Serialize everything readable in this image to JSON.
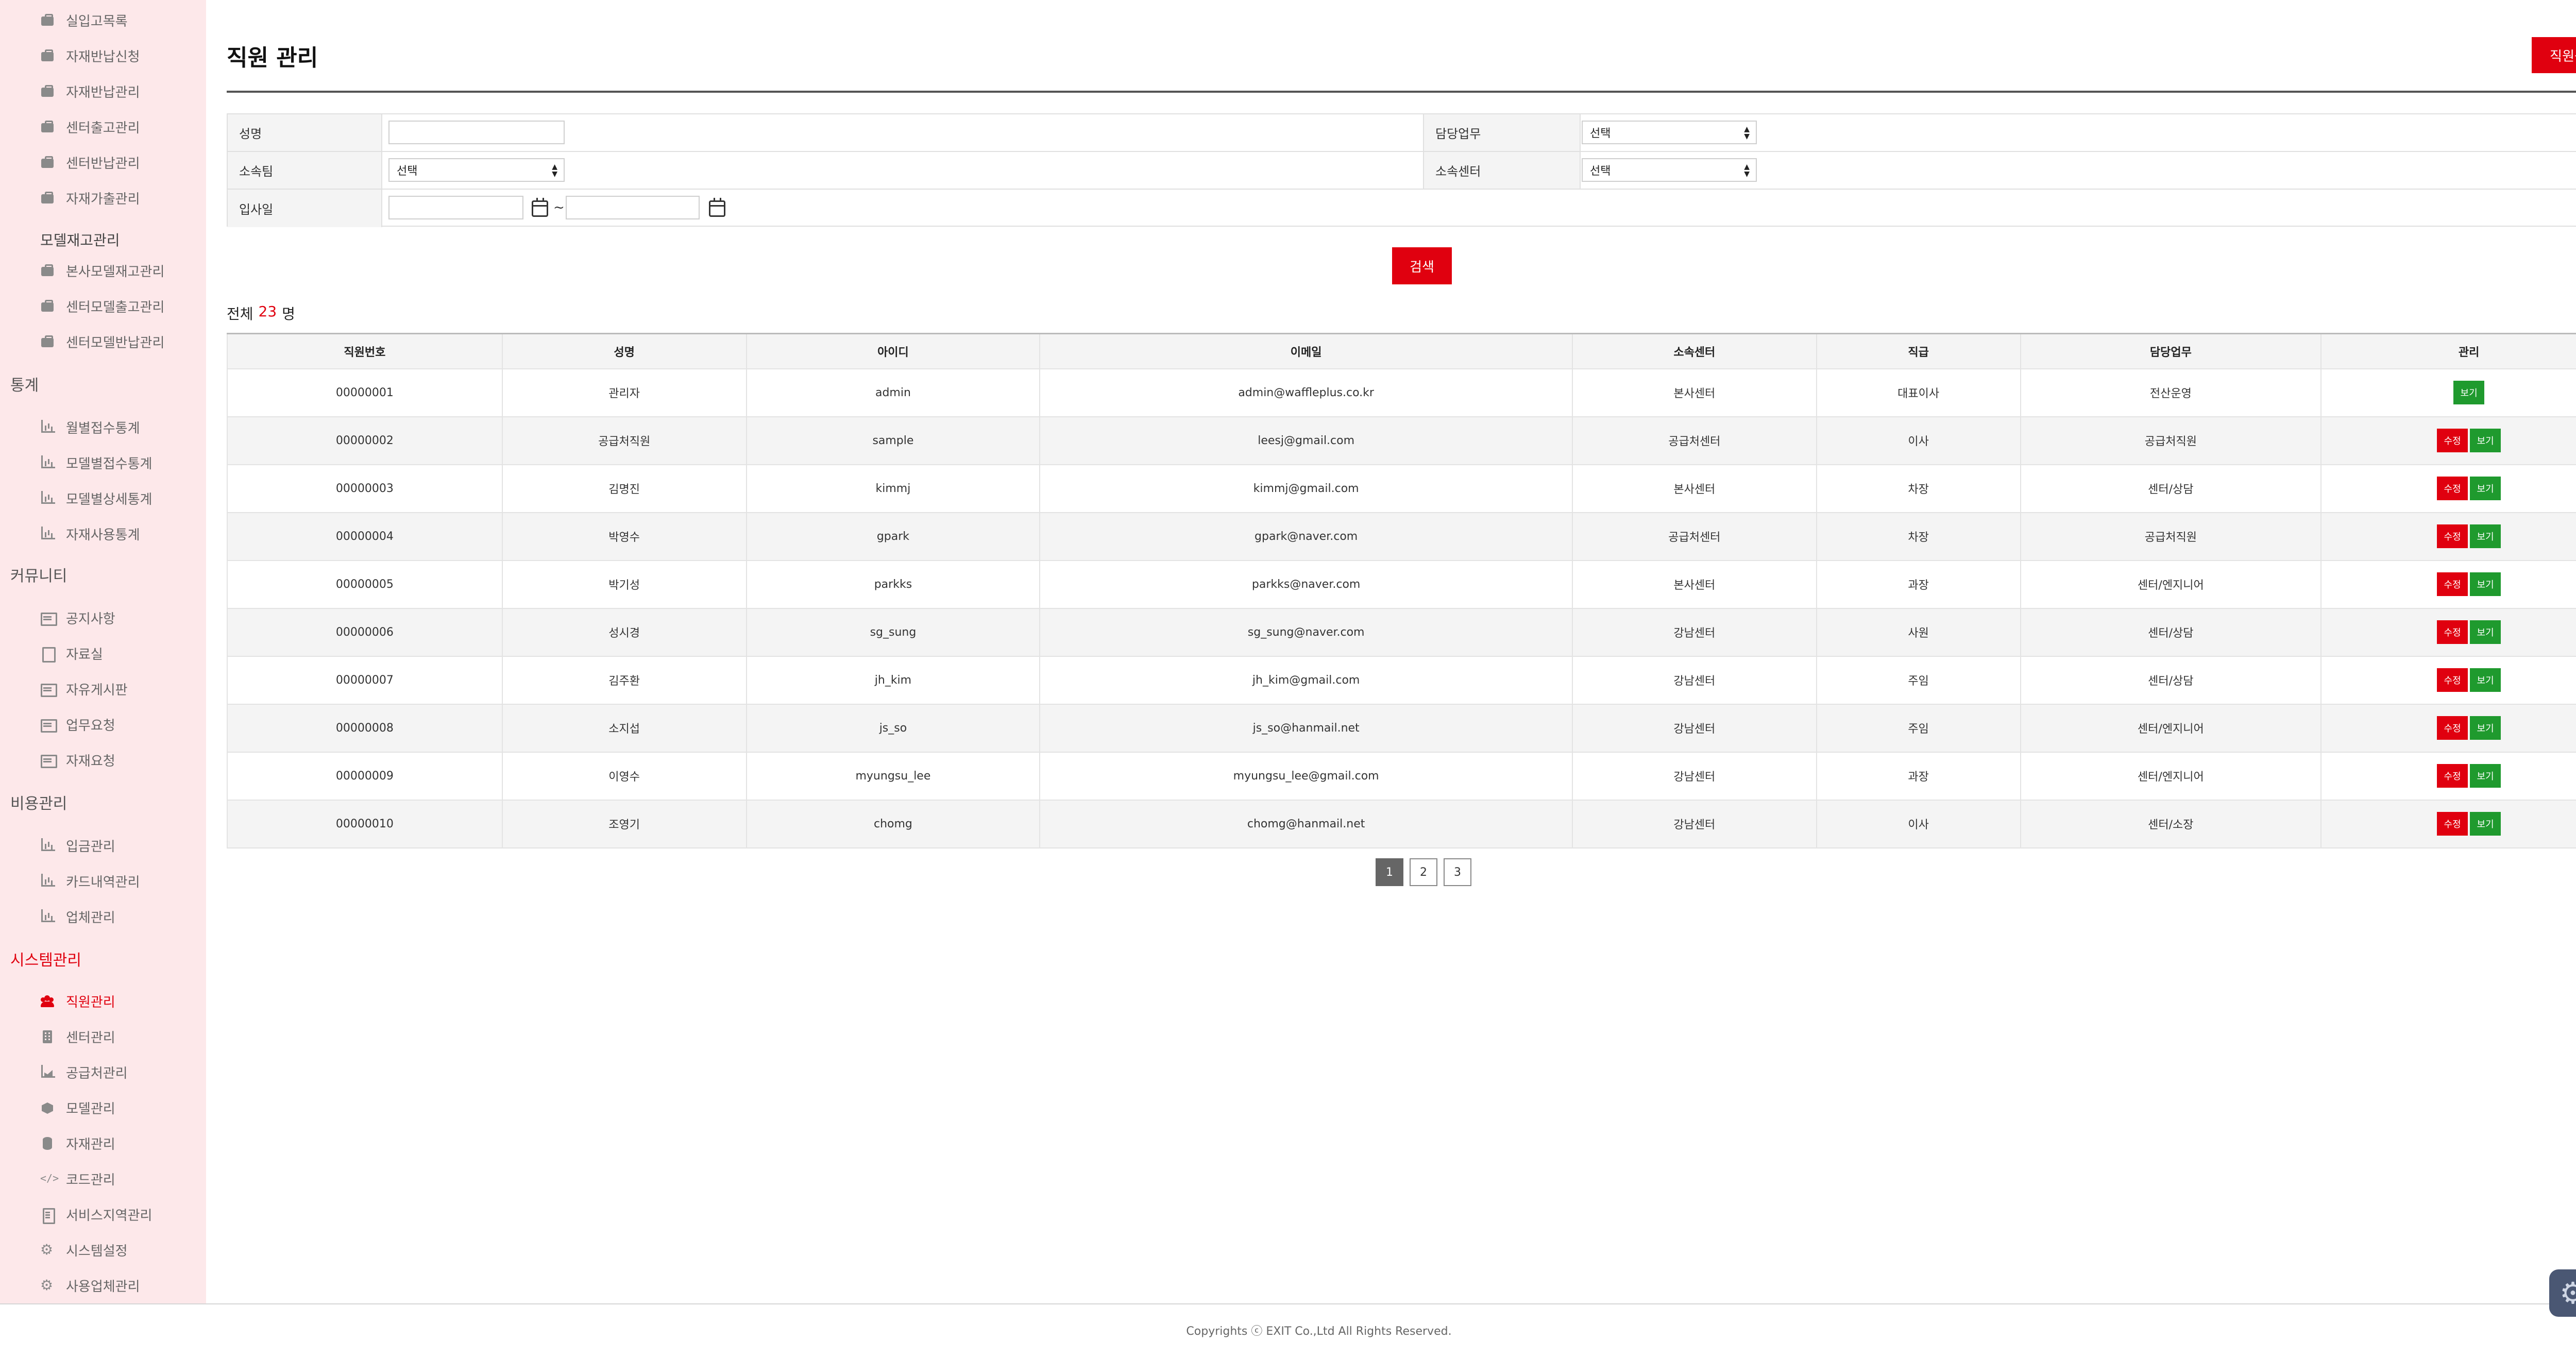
{
  "sidebar": {
    "items_top": [
      {
        "label": "실입고목록",
        "icon": "briefcase-icon"
      },
      {
        "label": "자재반납신청",
        "icon": "briefcase-icon"
      },
      {
        "label": "자재반납관리",
        "icon": "briefcase-icon"
      },
      {
        "label": "센터출고관리",
        "icon": "briefcase-icon"
      },
      {
        "label": "센터반납관리",
        "icon": "briefcase-icon"
      },
      {
        "label": "자재가출관리",
        "icon": "briefcase-icon"
      }
    ],
    "model_stock_heading": "모델재고관리",
    "model_stock_items": [
      {
        "label": "본사모델재고관리",
        "icon": "briefcase-icon"
      },
      {
        "label": "센터모델출고관리",
        "icon": "briefcase-icon"
      },
      {
        "label": "센터모델반납관리",
        "icon": "briefcase-icon"
      }
    ],
    "stats_heading": "통계",
    "stats_items": [
      {
        "label": "월별접수통계",
        "icon": "chart-icon"
      },
      {
        "label": "모델별접수통계",
        "icon": "chart-icon"
      },
      {
        "label": "모델별상세통계",
        "icon": "chart-icon"
      },
      {
        "label": "자재사용통계",
        "icon": "chart-icon"
      }
    ],
    "community_heading": "커뮤니티",
    "community_items": [
      {
        "label": "공지사항",
        "icon": "board-icon"
      },
      {
        "label": "자료실",
        "icon": "file-icon"
      },
      {
        "label": "자유게시판",
        "icon": "board-icon"
      },
      {
        "label": "업무요청",
        "icon": "board-icon"
      },
      {
        "label": "자재요청",
        "icon": "board-icon"
      }
    ],
    "cost_heading": "비용관리",
    "cost_items": [
      {
        "label": "입금관리",
        "icon": "chart-icon"
      },
      {
        "label": "카드내역관리",
        "icon": "chart-icon"
      },
      {
        "label": "업체관리",
        "icon": "chart-icon"
      }
    ],
    "system_heading": "시스템관리",
    "system_items": [
      {
        "label": "직원관리",
        "icon": "users-icon",
        "active": true
      },
      {
        "label": "센터관리",
        "icon": "building-icon"
      },
      {
        "label": "공급처관리",
        "icon": "area-chart-icon"
      },
      {
        "label": "모델관리",
        "icon": "cube-icon"
      },
      {
        "label": "자재관리",
        "icon": "database-icon"
      },
      {
        "label": "코드관리",
        "icon": "code-icon"
      },
      {
        "label": "서비스지역관리",
        "icon": "document-icon"
      },
      {
        "label": "시스템설정",
        "icon": "gear-icon"
      },
      {
        "label": "사용업체관리",
        "icon": "gear-icon"
      }
    ]
  },
  "header": {
    "title": "직원 관리",
    "register_label": "직원등록"
  },
  "search": {
    "name_label": "성명",
    "name_value": "",
    "duty_label": "담당업무",
    "duty_value": "선택",
    "team_label": "소속팀",
    "team_value": "선택",
    "center_label": "소속센터",
    "center_value": "선택",
    "join_label": "입사일",
    "join_from": "",
    "join_to": "",
    "tilde": "~",
    "search_label": "검색"
  },
  "summary": {
    "prefix": "전체",
    "count": "23",
    "suffix": "명"
  },
  "table": {
    "headers": [
      "직원번호",
      "성명",
      "아이디",
      "이메일",
      "소속센터",
      "직급",
      "담당업무",
      "관리"
    ],
    "edit_label": "수정",
    "view_label": "보기",
    "rows": [
      {
        "no": "00000001",
        "name": "관리자",
        "id": "admin",
        "email": "admin@waffleplus.co.kr",
        "center": "본사센터",
        "rank": "대표이사",
        "duty": "전산운영",
        "editable": false
      },
      {
        "no": "00000002",
        "name": "공급처직원",
        "id": "sample",
        "email": "leesj@gmail.com",
        "center": "공급처센터",
        "rank": "이사",
        "duty": "공급처직원",
        "editable": true
      },
      {
        "no": "00000003",
        "name": "김명진",
        "id": "kimmj",
        "email": "kimmj@gmail.com",
        "center": "본사센터",
        "rank": "차장",
        "duty": "센터/상담",
        "editable": true
      },
      {
        "no": "00000004",
        "name": "박영수",
        "id": "gpark",
        "email": "gpark@naver.com",
        "center": "공급처센터",
        "rank": "차장",
        "duty": "공급처직원",
        "editable": true
      },
      {
        "no": "00000005",
        "name": "박기성",
        "id": "parkks",
        "email": "parkks@naver.com",
        "center": "본사센터",
        "rank": "과장",
        "duty": "센터/엔지니어",
        "editable": true
      },
      {
        "no": "00000006",
        "name": "성시경",
        "id": "sg_sung",
        "email": "sg_sung@naver.com",
        "center": "강남센터",
        "rank": "사원",
        "duty": "센터/상담",
        "editable": true
      },
      {
        "no": "00000007",
        "name": "김주환",
        "id": "jh_kim",
        "email": "jh_kim@gmail.com",
        "center": "강남센터",
        "rank": "주임",
        "duty": "센터/상담",
        "editable": true
      },
      {
        "no": "00000008",
        "name": "소지섭",
        "id": "js_so",
        "email": "js_so@hanmail.net",
        "center": "강남센터",
        "rank": "주임",
        "duty": "센터/엔지니어",
        "editable": true
      },
      {
        "no": "00000009",
        "name": "이영수",
        "id": "myungsu_lee",
        "email": "myungsu_lee@gmail.com",
        "center": "강남센터",
        "rank": "과장",
        "duty": "센터/엔지니어",
        "editable": true
      },
      {
        "no": "00000010",
        "name": "조영기",
        "id": "chomg",
        "email": "chomg@hanmail.net",
        "center": "강남센터",
        "rank": "이사",
        "duty": "센터/소장",
        "editable": true
      }
    ]
  },
  "pagination": {
    "pages": [
      "1",
      "2",
      "3"
    ],
    "current": "1"
  },
  "footer": {
    "copyright": "Copyrights ⓒ EXIT Co.,Ltd All Rights Reserved."
  },
  "colors": {
    "accent": "#e0000f",
    "view_button": "#1f9a2e",
    "sidebar_bg": "#fde8ea"
  }
}
